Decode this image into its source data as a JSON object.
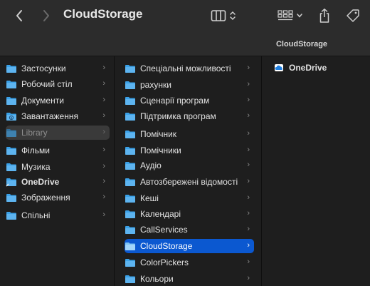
{
  "window": {
    "title": "CloudStorage",
    "path_label": "CloudStorage"
  },
  "toolbar": {
    "back_icon": "chevron-left-icon",
    "forward_icon": "chevron-right-icon",
    "view_icon": "column-view-icon",
    "group_icon": "group-grid-icon",
    "share_icon": "share-icon",
    "tag_icon": "tag-icon"
  },
  "column1": {
    "items": [
      {
        "label": "Застосунки",
        "icon": "folder-icon"
      },
      {
        "label": "Робочий стіл",
        "icon": "folder-icon"
      },
      {
        "label": "Документи",
        "icon": "folder-icon"
      },
      {
        "label": "Завантаження",
        "icon": "folder-download-icon"
      },
      {
        "label": "Library",
        "icon": "folder-icon"
      },
      {
        "label": "Фільми",
        "icon": "folder-icon"
      },
      {
        "label": "Музика",
        "icon": "folder-icon"
      },
      {
        "label": "OneDrive",
        "icon": "onedrive-folder-icon"
      },
      {
        "label": "Зображення",
        "icon": "folder-icon"
      },
      {
        "label": "Спільні",
        "icon": "folder-icon"
      }
    ]
  },
  "column2": {
    "items": [
      {
        "label": "Спеціальні можливості"
      },
      {
        "label": "рахунки"
      },
      {
        "label": "Сценарії програм"
      },
      {
        "label": "Підтримка програм"
      },
      {
        "label": "Помічник"
      },
      {
        "label": "Помічники"
      },
      {
        "label": "Аудіо"
      },
      {
        "label": "Автозбережені відомості"
      },
      {
        "label": "Кеші"
      },
      {
        "label": "Календарі"
      },
      {
        "label": "CallServices"
      },
      {
        "label": "CloudStorage"
      },
      {
        "label": "ColorPickers"
      },
      {
        "label": "Кольори"
      }
    ]
  },
  "column3": {
    "items": [
      {
        "label": "OneDrive",
        "icon": "onedrive-cloud-icon"
      }
    ]
  },
  "colors": {
    "folder": "#3aa1e8",
    "selection": "#0b58d0",
    "background": "#1e1e1e",
    "toolbar": "#2c2c2c"
  }
}
